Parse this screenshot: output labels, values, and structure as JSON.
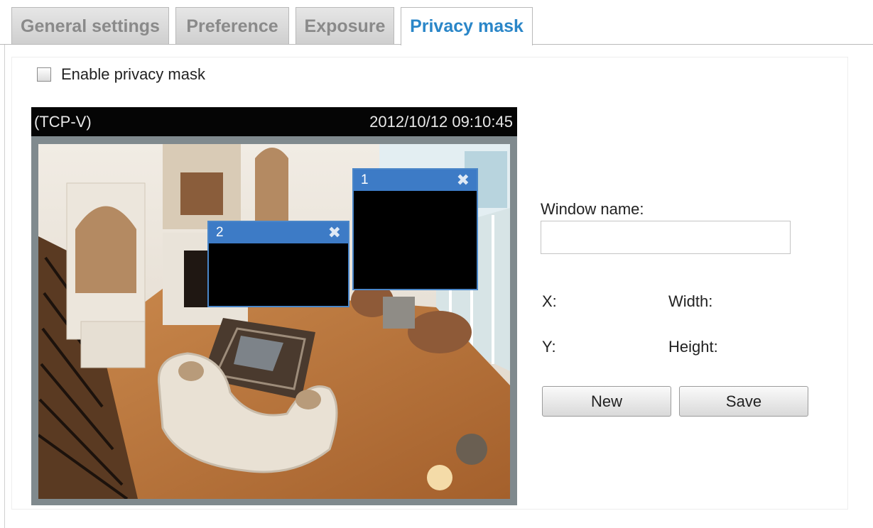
{
  "tabs": [
    {
      "label": "General settings",
      "active": false
    },
    {
      "label": "Preference",
      "active": false
    },
    {
      "label": "Exposure",
      "active": false
    },
    {
      "label": "Privacy mask",
      "active": true
    }
  ],
  "enable_privacy_mask": {
    "label": "Enable privacy mask",
    "checked": false
  },
  "video": {
    "source": "(TCP-V)",
    "timestamp": "2012/10/12 09:10:45"
  },
  "masks": [
    {
      "id": "1"
    },
    {
      "id": "2"
    }
  ],
  "form": {
    "window_name_label": "Window name:",
    "window_name_value": "",
    "x_label": "X:",
    "width_label": "Width:",
    "y_label": "Y:",
    "height_label": "Height:",
    "new_button": "New",
    "save_button": "Save"
  },
  "colors": {
    "active_tab_text": "#2a86c8",
    "mask_titlebar": "#3d7bc6",
    "mask_border": "#4a86c8"
  },
  "icons": {
    "mask_close": "close-icon"
  }
}
